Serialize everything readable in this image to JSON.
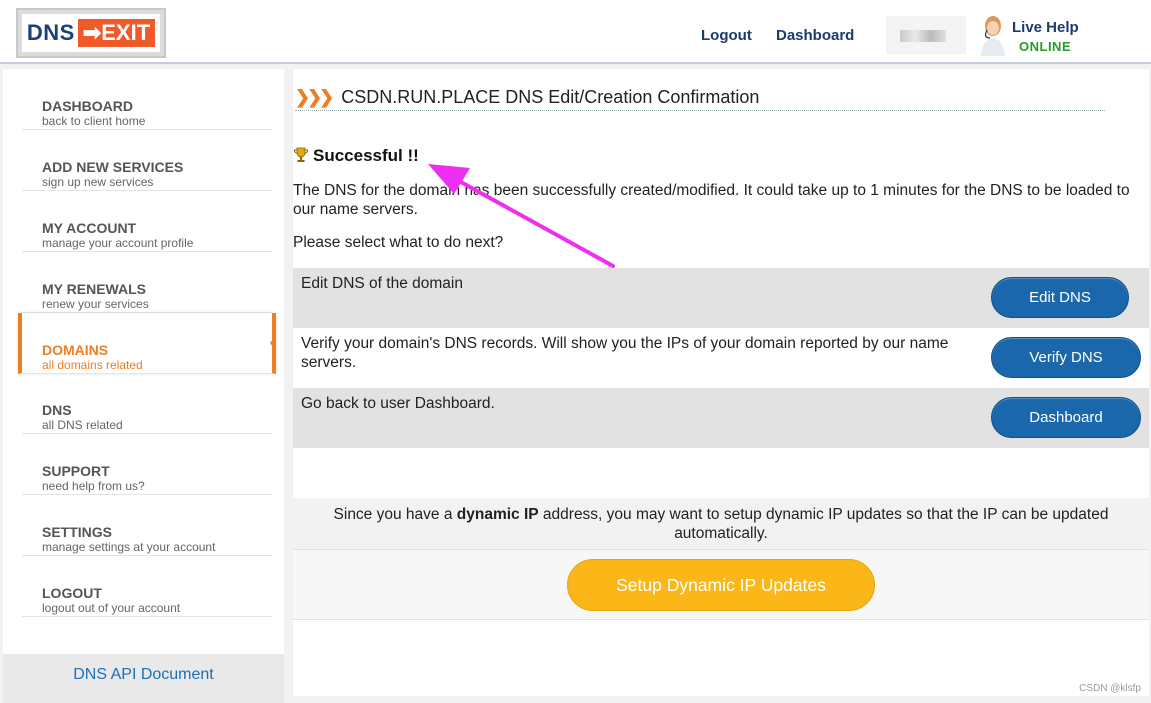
{
  "header": {
    "logo_dns": "DNS",
    "logo_exit": "EXIT",
    "logout": "Logout",
    "dashboard": "Dashboard",
    "live_help": "Live Help",
    "live_status": "ONLINE"
  },
  "sidebar": {
    "items": [
      {
        "title": "DASHBOARD",
        "sub": "back to client home"
      },
      {
        "title": "ADD NEW SERVICES",
        "sub": "sign up new services"
      },
      {
        "title": "MY ACCOUNT",
        "sub": "manage your account profile"
      },
      {
        "title": "MY RENEWALS",
        "sub": "renew your services"
      },
      {
        "title": "DOMAINS",
        "sub": "all domains related"
      },
      {
        "title": "DNS",
        "sub": "all DNS related"
      },
      {
        "title": "SUPPORT",
        "sub": "need help from us?"
      },
      {
        "title": "SETTINGS",
        "sub": "manage settings at your account"
      },
      {
        "title": "LOGOUT",
        "sub": "logout out of your account"
      }
    ],
    "footer_link": "DNS API Document"
  },
  "main": {
    "title": "CSDN.RUN.PLACE DNS Edit/Creation Confirmation",
    "success": "Successful !!",
    "message": "The DNS for the domain has been successfully created/modified. It could take up to 1 minutes for the DNS to be loaded to our name servers.",
    "prompt": "Please select what to do next?",
    "options": [
      {
        "text": "Edit DNS of the domain",
        "button": "Edit DNS"
      },
      {
        "text": "Verify your domain's DNS records. Will show you the IPs of your domain reported by our name servers.",
        "button": "Verify DNS"
      },
      {
        "text": "Go back to user Dashboard.",
        "button": "Dashboard"
      }
    ],
    "dynamic_pre": "Since you have a ",
    "dynamic_bold": "dynamic IP",
    "dynamic_post": " address, you may want to setup dynamic IP updates so that the IP can be updated automatically.",
    "dynamic_button": "Setup Dynamic IP Updates"
  },
  "watermark": "CSDN @klsfp",
  "colors": {
    "accent_orange": "#ef7e22",
    "button_blue": "#1a68ab",
    "button_yellow": "#fbb717",
    "arrow_magenta": "#ee2ef0"
  }
}
